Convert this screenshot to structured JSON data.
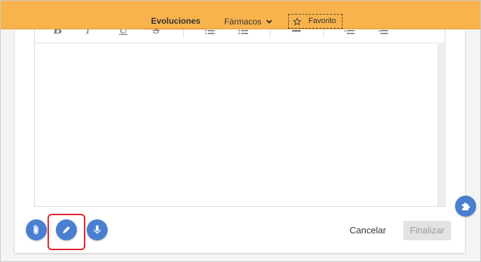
{
  "tabs": {
    "evoluciones": "Evoluciones",
    "farmacos": "Fármacos",
    "favorito": "Favorito"
  },
  "toolbar": {
    "bold": "B",
    "italic": "I",
    "underline": "U",
    "strike": "S"
  },
  "actions": {
    "cancel": "Cancelar",
    "finalize": "Finalizar"
  },
  "colors": {
    "topbar": "#f9b34d",
    "active_tab_underline": "#e87c1a",
    "fab": "#4a7fd0",
    "highlight": "#e0202a"
  },
  "icons": {
    "attach": "paperclip-icon",
    "pencil": "pencil-icon",
    "mic": "microphone-icon",
    "puzzle": "puzzle-icon"
  }
}
